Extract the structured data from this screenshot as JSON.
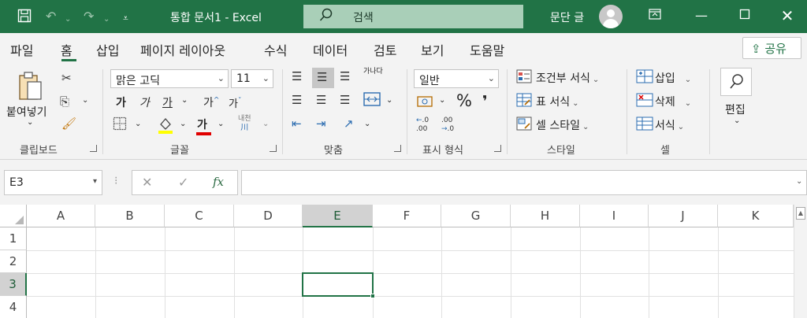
{
  "titlebar": {
    "doc_title": "통합 문서1  -  Excel",
    "search_label": "검색",
    "user_name": "문단 글",
    "colors": {
      "accent": "#217346",
      "search_bg": "#a9cfb8"
    }
  },
  "tabs": [
    "파일",
    "홈",
    "삽입",
    "페이지 레이아웃",
    "수식",
    "데이터",
    "검토",
    "보기",
    "도움말"
  ],
  "active_tab": "홈",
  "share_label": "공유",
  "ribbon": {
    "clipboard": {
      "label": "클립보드",
      "paste": "붙여넣기"
    },
    "font": {
      "label": "글꼴",
      "name": "맑은 고딕",
      "size": "11",
      "bold": "가",
      "italic": "가",
      "underline": "가",
      "grow": "가",
      "shrink": "가",
      "font_color": "가",
      "phonetic_top": "내천",
      "phonetic_bottom": "川"
    },
    "alignment": {
      "label": "맞춤",
      "wrap": "가나다"
    },
    "number": {
      "label": "표시 형식",
      "format": "일반",
      "percent": "%",
      "comma": "❜",
      "inc_dec": ".00",
      "dec_dec": ".00"
    },
    "styles": {
      "label": "스타일",
      "conditional": "조건부 서식",
      "table": "표 서식",
      "cell": "셀 스타일"
    },
    "cells": {
      "label": "셀",
      "insert": "삽입",
      "delete": "삭제",
      "format": "서식"
    },
    "editing": {
      "label": "편집"
    }
  },
  "formula": {
    "name_box": "E3",
    "fx": "fx"
  },
  "grid": {
    "columns": [
      "A",
      "B",
      "C",
      "D",
      "E",
      "F",
      "G",
      "H",
      "I",
      "J",
      "K"
    ],
    "rows": [
      "1",
      "2",
      "3",
      "4"
    ],
    "selected_cell": "E3"
  }
}
